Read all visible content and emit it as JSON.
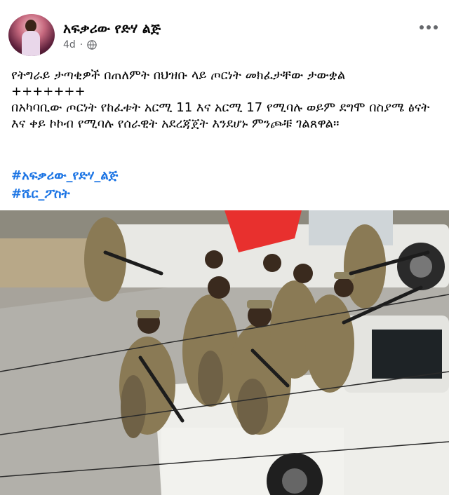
{
  "post": {
    "author": "አፍቃሪው የድሃ ልጅ",
    "time": "4d",
    "dot": "·",
    "privacy_icon": "globe-icon",
    "more_icon": "more-options-icon",
    "text_lines": [
      "የትግራይ ታጣቂዎች በጠለምት በህዝቡ ላይ ጦርነት መክፈታቸው ታውቋል",
      "+++++++",
      "በአካባቢው ጦርነት የከፈቱት አርሚ 11 እና አርሚ 17 የሚባሉ ወይም ደግሞ በስያሜ ፅናት እና ቀይ ኮኮብ የሚባሉ የሰራዊት አደረጃጀት እንደሆኑ ምንጮቹ ገልጸዋል።"
    ],
    "hashtags": [
      "#አፍቃሪው_የድሃ_ልጅ",
      "#ሼር_ፖስት"
    ],
    "photo_icon": "post-photo"
  },
  "colors": {
    "text": "#050505",
    "meta": "#65676b",
    "hashtag": "#1b74e4",
    "uniform": "#8a7a55",
    "truck": "#eeeeea",
    "flag": "#e8302e"
  }
}
